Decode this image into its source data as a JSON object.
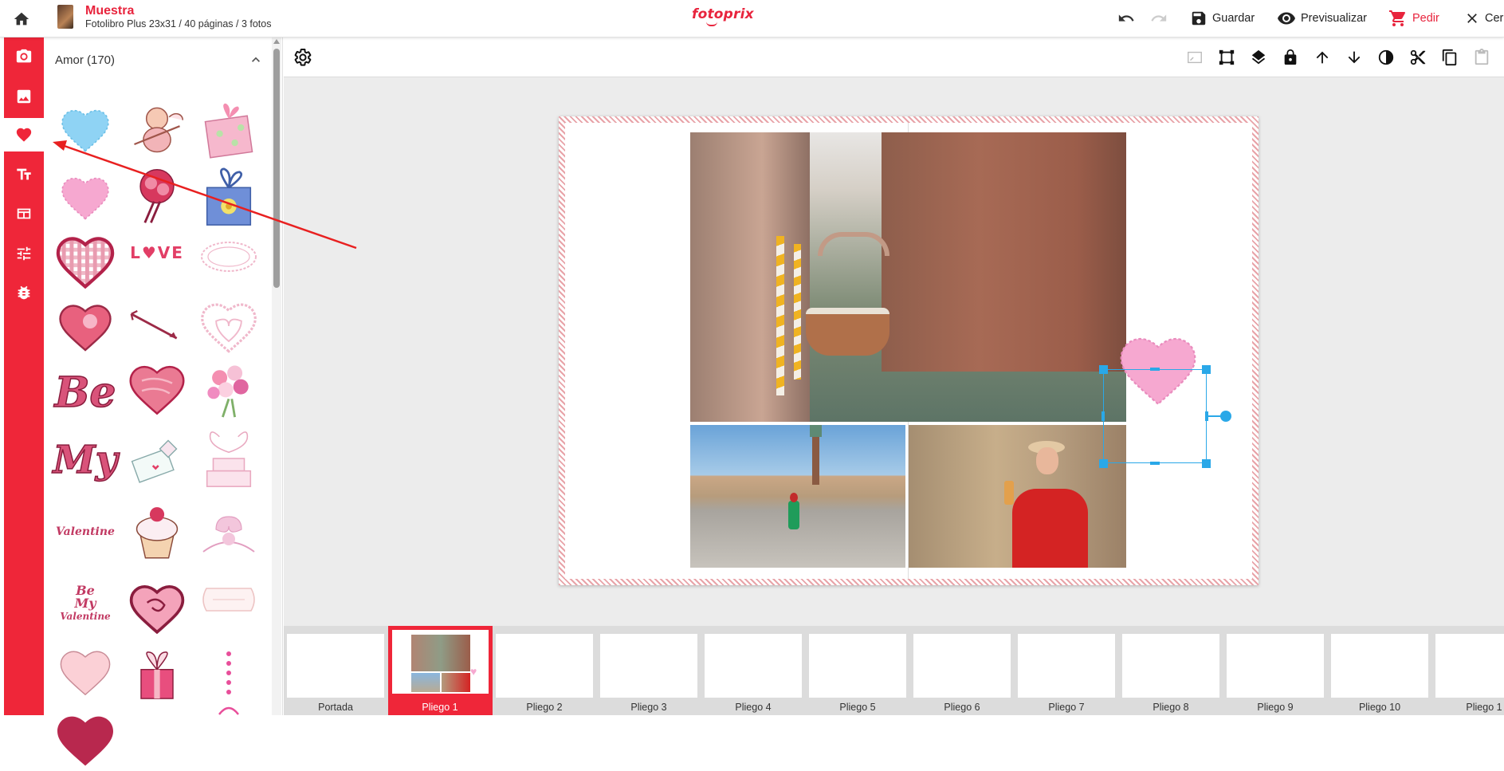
{
  "header": {
    "project_title": "Muestra",
    "project_subtitle": "Fotolibro Plus 23x31 / 40 páginas / 3 fotos",
    "brand": "fotoprix",
    "save_label": "Guardar",
    "preview_label": "Previsualizar",
    "order_label": "Pedir",
    "close_label": "Cer"
  },
  "panel": {
    "heading": "Amor (170)"
  },
  "filmstrip": {
    "pages": [
      "Portada",
      "Pliego 1",
      "Pliego 2",
      "Pliego 3",
      "Pliego 4",
      "Pliego 5",
      "Pliego 6",
      "Pliego 7",
      "Pliego 8",
      "Pliego 9",
      "Pliego 10",
      "Pliego 1"
    ],
    "active_index": 1
  },
  "colors": {
    "accent": "#ef2639",
    "selection": "#2aa8e8"
  }
}
